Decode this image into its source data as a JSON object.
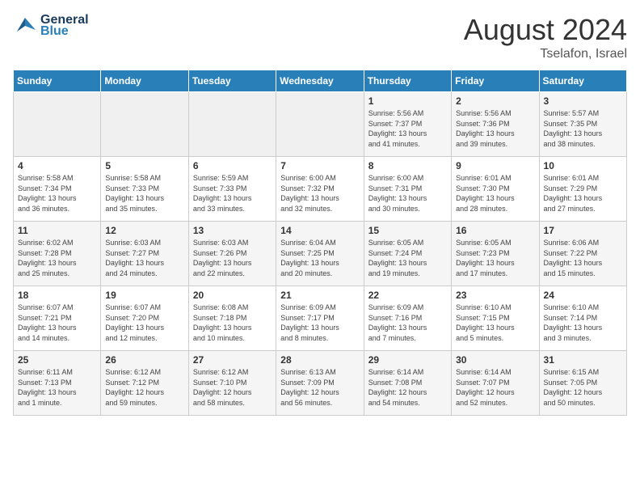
{
  "header": {
    "logo_line1": "General",
    "logo_line2": "Blue",
    "month_year": "August 2024",
    "location": "Tselafon, Israel"
  },
  "days_of_week": [
    "Sunday",
    "Monday",
    "Tuesday",
    "Wednesday",
    "Thursday",
    "Friday",
    "Saturday"
  ],
  "weeks": [
    [
      {
        "day": "",
        "info": ""
      },
      {
        "day": "",
        "info": ""
      },
      {
        "day": "",
        "info": ""
      },
      {
        "day": "",
        "info": ""
      },
      {
        "day": "1",
        "info": "Sunrise: 5:56 AM\nSunset: 7:37 PM\nDaylight: 13 hours\nand 41 minutes."
      },
      {
        "day": "2",
        "info": "Sunrise: 5:56 AM\nSunset: 7:36 PM\nDaylight: 13 hours\nand 39 minutes."
      },
      {
        "day": "3",
        "info": "Sunrise: 5:57 AM\nSunset: 7:35 PM\nDaylight: 13 hours\nand 38 minutes."
      }
    ],
    [
      {
        "day": "4",
        "info": "Sunrise: 5:58 AM\nSunset: 7:34 PM\nDaylight: 13 hours\nand 36 minutes."
      },
      {
        "day": "5",
        "info": "Sunrise: 5:58 AM\nSunset: 7:33 PM\nDaylight: 13 hours\nand 35 minutes."
      },
      {
        "day": "6",
        "info": "Sunrise: 5:59 AM\nSunset: 7:33 PM\nDaylight: 13 hours\nand 33 minutes."
      },
      {
        "day": "7",
        "info": "Sunrise: 6:00 AM\nSunset: 7:32 PM\nDaylight: 13 hours\nand 32 minutes."
      },
      {
        "day": "8",
        "info": "Sunrise: 6:00 AM\nSunset: 7:31 PM\nDaylight: 13 hours\nand 30 minutes."
      },
      {
        "day": "9",
        "info": "Sunrise: 6:01 AM\nSunset: 7:30 PM\nDaylight: 13 hours\nand 28 minutes."
      },
      {
        "day": "10",
        "info": "Sunrise: 6:01 AM\nSunset: 7:29 PM\nDaylight: 13 hours\nand 27 minutes."
      }
    ],
    [
      {
        "day": "11",
        "info": "Sunrise: 6:02 AM\nSunset: 7:28 PM\nDaylight: 13 hours\nand 25 minutes."
      },
      {
        "day": "12",
        "info": "Sunrise: 6:03 AM\nSunset: 7:27 PM\nDaylight: 13 hours\nand 24 minutes."
      },
      {
        "day": "13",
        "info": "Sunrise: 6:03 AM\nSunset: 7:26 PM\nDaylight: 13 hours\nand 22 minutes."
      },
      {
        "day": "14",
        "info": "Sunrise: 6:04 AM\nSunset: 7:25 PM\nDaylight: 13 hours\nand 20 minutes."
      },
      {
        "day": "15",
        "info": "Sunrise: 6:05 AM\nSunset: 7:24 PM\nDaylight: 13 hours\nand 19 minutes."
      },
      {
        "day": "16",
        "info": "Sunrise: 6:05 AM\nSunset: 7:23 PM\nDaylight: 13 hours\nand 17 minutes."
      },
      {
        "day": "17",
        "info": "Sunrise: 6:06 AM\nSunset: 7:22 PM\nDaylight: 13 hours\nand 15 minutes."
      }
    ],
    [
      {
        "day": "18",
        "info": "Sunrise: 6:07 AM\nSunset: 7:21 PM\nDaylight: 13 hours\nand 14 minutes."
      },
      {
        "day": "19",
        "info": "Sunrise: 6:07 AM\nSunset: 7:20 PM\nDaylight: 13 hours\nand 12 minutes."
      },
      {
        "day": "20",
        "info": "Sunrise: 6:08 AM\nSunset: 7:18 PM\nDaylight: 13 hours\nand 10 minutes."
      },
      {
        "day": "21",
        "info": "Sunrise: 6:09 AM\nSunset: 7:17 PM\nDaylight: 13 hours\nand 8 minutes."
      },
      {
        "day": "22",
        "info": "Sunrise: 6:09 AM\nSunset: 7:16 PM\nDaylight: 13 hours\nand 7 minutes."
      },
      {
        "day": "23",
        "info": "Sunrise: 6:10 AM\nSunset: 7:15 PM\nDaylight: 13 hours\nand 5 minutes."
      },
      {
        "day": "24",
        "info": "Sunrise: 6:10 AM\nSunset: 7:14 PM\nDaylight: 13 hours\nand 3 minutes."
      }
    ],
    [
      {
        "day": "25",
        "info": "Sunrise: 6:11 AM\nSunset: 7:13 PM\nDaylight: 13 hours\nand 1 minute."
      },
      {
        "day": "26",
        "info": "Sunrise: 6:12 AM\nSunset: 7:12 PM\nDaylight: 12 hours\nand 59 minutes."
      },
      {
        "day": "27",
        "info": "Sunrise: 6:12 AM\nSunset: 7:10 PM\nDaylight: 12 hours\nand 58 minutes."
      },
      {
        "day": "28",
        "info": "Sunrise: 6:13 AM\nSunset: 7:09 PM\nDaylight: 12 hours\nand 56 minutes."
      },
      {
        "day": "29",
        "info": "Sunrise: 6:14 AM\nSunset: 7:08 PM\nDaylight: 12 hours\nand 54 minutes."
      },
      {
        "day": "30",
        "info": "Sunrise: 6:14 AM\nSunset: 7:07 PM\nDaylight: 12 hours\nand 52 minutes."
      },
      {
        "day": "31",
        "info": "Sunrise: 6:15 AM\nSunset: 7:05 PM\nDaylight: 12 hours\nand 50 minutes."
      }
    ]
  ]
}
